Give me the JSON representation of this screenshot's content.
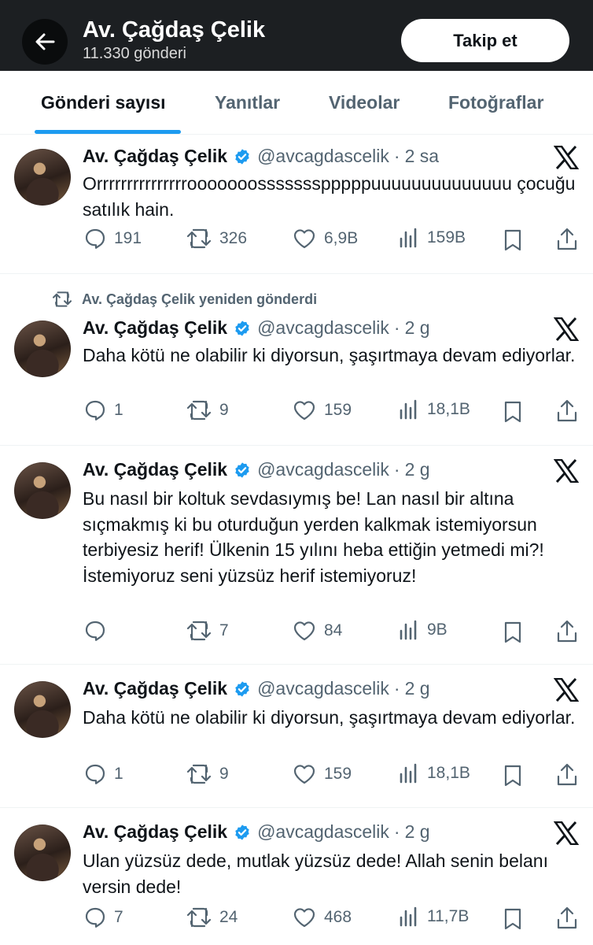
{
  "header": {
    "name": "Av. Çağdaş Çelik",
    "post_count": "11.330 gönderi",
    "follow_label": "Takip et"
  },
  "tabs": [
    {
      "label": "Gönderi sayısı",
      "active": true
    },
    {
      "label": "Yanıtlar",
      "active": false
    },
    {
      "label": "Videolar",
      "active": false
    },
    {
      "label": "Fotoğraflar",
      "active": false
    }
  ],
  "colors": {
    "accent": "#1d9bf0",
    "header_bg": "#1c1f22",
    "muted": "#536471"
  },
  "tweets": [
    {
      "retweet_label": "",
      "name": "Av. Çağdaş Çelik",
      "handle": "@avcagdascelik",
      "dot": "·",
      "time": "2 sa",
      "text": "Orrrrrrrrrrrrrrrooooooossssssspppppuuuuuuuuuuuuuu çocuğu satılık hain.",
      "replies": "191",
      "retweets": "326",
      "likes": "6,9B",
      "views": "159B"
    },
    {
      "retweet_label": "Av. Çağdaş Çelik yeniden gönderdi",
      "name": "Av. Çağdaş Çelik",
      "handle": "@avcagdascelik",
      "dot": "·",
      "time": "2 g",
      "text": "Daha kötü ne olabilir ki diyorsun, şaşırtmaya devam ediyorlar.",
      "replies": "1",
      "retweets": "9",
      "likes": "159",
      "views": "18,1B"
    },
    {
      "retweet_label": "",
      "name": "Av. Çağdaş Çelik",
      "handle": "@avcagdascelik",
      "dot": "·",
      "time": "2 g",
      "text": "Bu nasıl bir koltuk sevdasıymış be! Lan nasıl bir altına sıçmakmış ki bu oturduğun yerden kalkmak istemiyorsun terbiyesiz herif! Ülkenin 15 yılını heba ettiğin yetmedi mi?! İstemiyoruz seni yüzsüz herif istemiyoruz!",
      "replies": "",
      "retweets": "7",
      "likes": "84",
      "views": "9B"
    },
    {
      "retweet_label": "",
      "name": "Av. Çağdaş Çelik",
      "handle": "@avcagdascelik",
      "dot": "·",
      "time": "2 g",
      "text": "Daha kötü ne olabilir ki diyorsun, şaşırtmaya devam ediyorlar.",
      "replies": "1",
      "retweets": "9",
      "likes": "159",
      "views": "18,1B"
    },
    {
      "retweet_label": "",
      "name": "Av. Çağdaş Çelik",
      "handle": "@avcagdascelik",
      "dot": "·",
      "time": "2 g",
      "text": "Ulan yüzsüz dede, mutlak yüzsüz dede! Allah senin belanı versin dede!",
      "replies": "7",
      "retweets": "24",
      "likes": "468",
      "views": "11,7B"
    }
  ],
  "icons": {
    "back": "arrow-left-icon",
    "verified": "verified-badge-icon",
    "x": "x-logo-icon",
    "reply": "reply-icon",
    "retweet": "retweet-icon",
    "like": "heart-icon",
    "views": "views-icon",
    "bookmark": "bookmark-icon",
    "share": "share-icon"
  }
}
